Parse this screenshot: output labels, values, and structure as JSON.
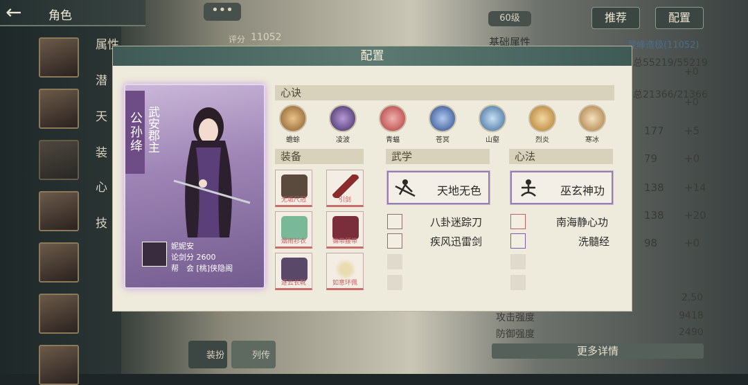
{
  "topbar": {
    "title": "角色"
  },
  "sidebar": {
    "labels": [
      "属性",
      "潜",
      "天",
      "装",
      "心",
      "技"
    ]
  },
  "header": {
    "level": "60级",
    "score_label": "评分",
    "score": "11052",
    "recommend": "推荐",
    "config": "配置"
  },
  "right": {
    "section_title": "基础属性",
    "rank": "登峰造极(11052)",
    "hp": "总55219/55219",
    "hp_add": "+0",
    "mp": "总21366/21366",
    "mp_add": "+0",
    "stats": [
      {
        "v": "177",
        "a": "+5"
      },
      {
        "v": "79",
        "a": "+0"
      },
      {
        "v": "138",
        "a": "+14"
      },
      {
        "v": "138",
        "a": "+20"
      },
      {
        "v": "98",
        "a": "+0"
      }
    ],
    "lower": [
      {
        "label": "",
        "value": "2.50"
      },
      {
        "label": "攻击强度",
        "value": "9418"
      },
      {
        "label": "防御强度",
        "value": "2490"
      }
    ],
    "more": "更多详情"
  },
  "bottom": {
    "btn1": "装扮",
    "btn2": "列传"
  },
  "dialog": {
    "title": "配置",
    "card": {
      "name": "公孙绛",
      "subtitle": "武安郡主",
      "player": "妮妮安",
      "score": "论剑分 2600",
      "guild": "帮　会 [桃]侠隐阁"
    },
    "xinjue_title": "心诀",
    "xinjue": [
      {
        "label": "蟾蜍",
        "color": "#b5855a"
      },
      {
        "label": "凌波",
        "color": "#6b4a8e"
      },
      {
        "label": "青蝠",
        "color": "#c44a4a"
      },
      {
        "label": "苍冥",
        "color": "#4a6fb3"
      },
      {
        "label": "山壑",
        "color": "#5a8ab0"
      },
      {
        "label": "烈炎",
        "color": "#c89040"
      },
      {
        "label": "寒冰",
        "color": "#b8864a"
      }
    ],
    "equip_title": "装备",
    "equip": [
      {
        "label": "无垢尺冠",
        "color": "#5a4a3e"
      },
      {
        "label": "引剑",
        "color": "#8a2c2c"
      },
      {
        "label": "烟雨衫衣",
        "color": "#7ab89a"
      },
      {
        "label": "锦带腰带",
        "color": "#7a2e3c"
      },
      {
        "label": "逐云长靴",
        "color": "#5a4868"
      },
      {
        "label": "如意环佩",
        "color": "#d4c088"
      }
    ],
    "wuxue_title": "武学",
    "wuxue_main": "天地无色",
    "wuxue_list": [
      "八卦迷踪刀",
      "疾风迅雷剑"
    ],
    "xinfa_title": "心法",
    "xinfa_main": "巫玄神功",
    "xinfa_list": [
      "南海静心功",
      "洗髓经"
    ]
  }
}
